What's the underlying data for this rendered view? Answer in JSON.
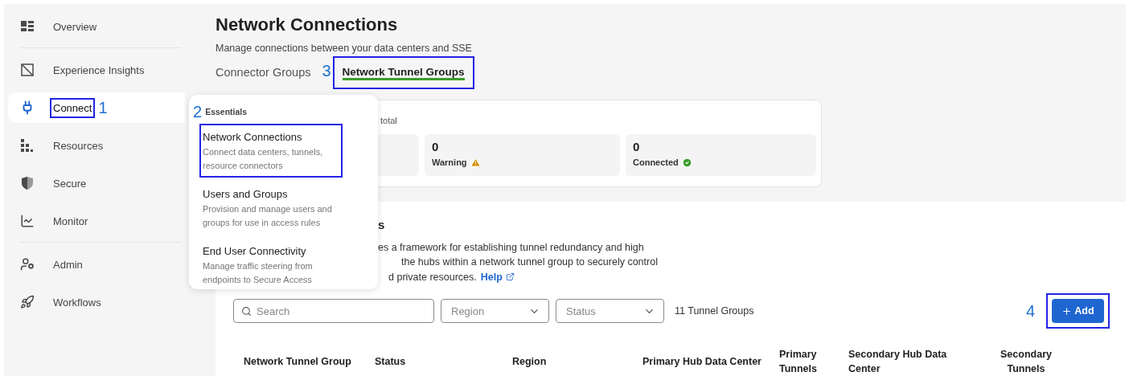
{
  "sidebar": {
    "groups": [
      {
        "items": [
          {
            "label": "Overview",
            "selected": false,
            "highlighted": false
          }
        ]
      },
      {
        "items": [
          {
            "label": "Experience Insights",
            "selected": false,
            "highlighted": false
          },
          {
            "label": "Connect",
            "selected": true,
            "highlighted": true,
            "callout": "1"
          },
          {
            "label": "Resources",
            "selected": false,
            "highlighted": false
          },
          {
            "label": "Secure",
            "selected": false,
            "highlighted": false
          },
          {
            "label": "Monitor",
            "selected": false,
            "highlighted": false
          }
        ]
      },
      {
        "items": [
          {
            "label": "Admin",
            "selected": false,
            "highlighted": false
          },
          {
            "label": "Workflows",
            "selected": false,
            "highlighted": false
          }
        ]
      }
    ]
  },
  "menu": {
    "callout": "2",
    "heading": "Essentials",
    "items": [
      {
        "title": "Network Connections",
        "description": "Connect data centers, tunnels, resource connectors",
        "highlighted": true
      },
      {
        "title": "Users and Groups",
        "description": "Provision and manage users and groups for use in access rules",
        "highlighted": false
      },
      {
        "title": "End User Connectivity",
        "description": "Manage traffic steering from endpoints to Secure Access",
        "highlighted": false
      }
    ]
  },
  "header": {
    "title": "Network Connections",
    "subtitle": "Manage connections between your data centers and SSE",
    "tabs": [
      {
        "label": "Connector Groups",
        "selected": false,
        "highlighted": false
      },
      {
        "label": "Network Tunnel Groups",
        "selected": true,
        "highlighted": true,
        "callout": "3"
      }
    ]
  },
  "summary": {
    "caption": "total",
    "tiles": [
      {
        "kind": "covered"
      },
      {
        "kind": "warning",
        "value": "0",
        "label": "Warning"
      },
      {
        "kind": "connected",
        "value": "0",
        "label": "Connected"
      }
    ]
  },
  "section": {
    "heading": "s",
    "lines": [
      "es a framework for establishing tunnel redundancy and high",
      "the hubs within a network tunnel group to securely control",
      "d private resources."
    ],
    "help_link": "Help"
  },
  "toolbar": {
    "search_placeholder": "Search",
    "filters": [
      "Region",
      "Status"
    ],
    "count": "11 Tunnel Groups",
    "add_button": {
      "label": "Add",
      "highlighted": true,
      "callout": "4"
    }
  },
  "table": {
    "columns": [
      "Network Tunnel Group",
      "Status",
      "Region",
      "Primary Hub Data Center",
      "Primary Tunnels",
      "Secondary Hub Data Center",
      "Secondary Tunnels"
    ]
  }
}
